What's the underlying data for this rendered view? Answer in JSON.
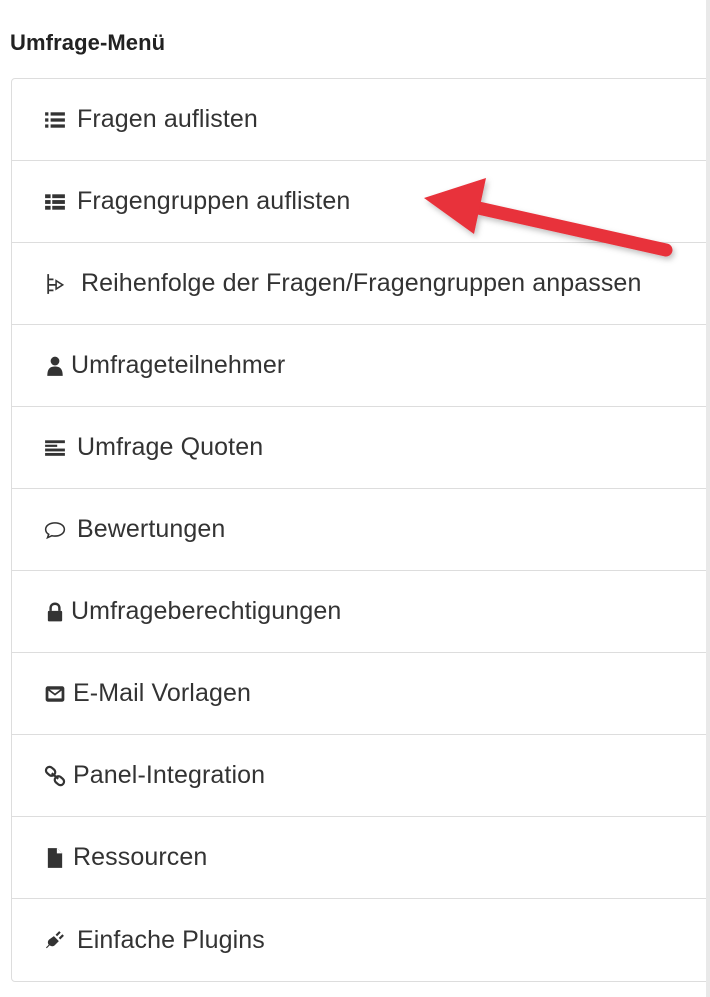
{
  "menu": {
    "title": "Umfrage-Menü",
    "items": [
      {
        "label": "Fragen auflisten",
        "icon": "list-icon"
      },
      {
        "label": "Fragengruppen auflisten",
        "icon": "list-groups-icon"
      },
      {
        "label": "Reihenfolge der Fragen/Fragengruppen anpassen",
        "icon": "reorder-icon"
      },
      {
        "label": "Umfrageteilnehmer",
        "icon": "user-icon"
      },
      {
        "label": "Umfrage Quoten",
        "icon": "quota-icon"
      },
      {
        "label": "Bewertungen",
        "icon": "comment-icon"
      },
      {
        "label": "Umfrageberechtigungen",
        "icon": "lock-icon"
      },
      {
        "label": "E-Mail Vorlagen",
        "icon": "envelope-icon"
      },
      {
        "label": "Panel-Integration",
        "icon": "link-icon"
      },
      {
        "label": "Ressourcen",
        "icon": "file-icon"
      },
      {
        "label": "Einfache Plugins",
        "icon": "plug-icon"
      }
    ]
  },
  "annotation": {
    "color": "#e8303a",
    "points_to": "Fragengruppen auflisten"
  }
}
